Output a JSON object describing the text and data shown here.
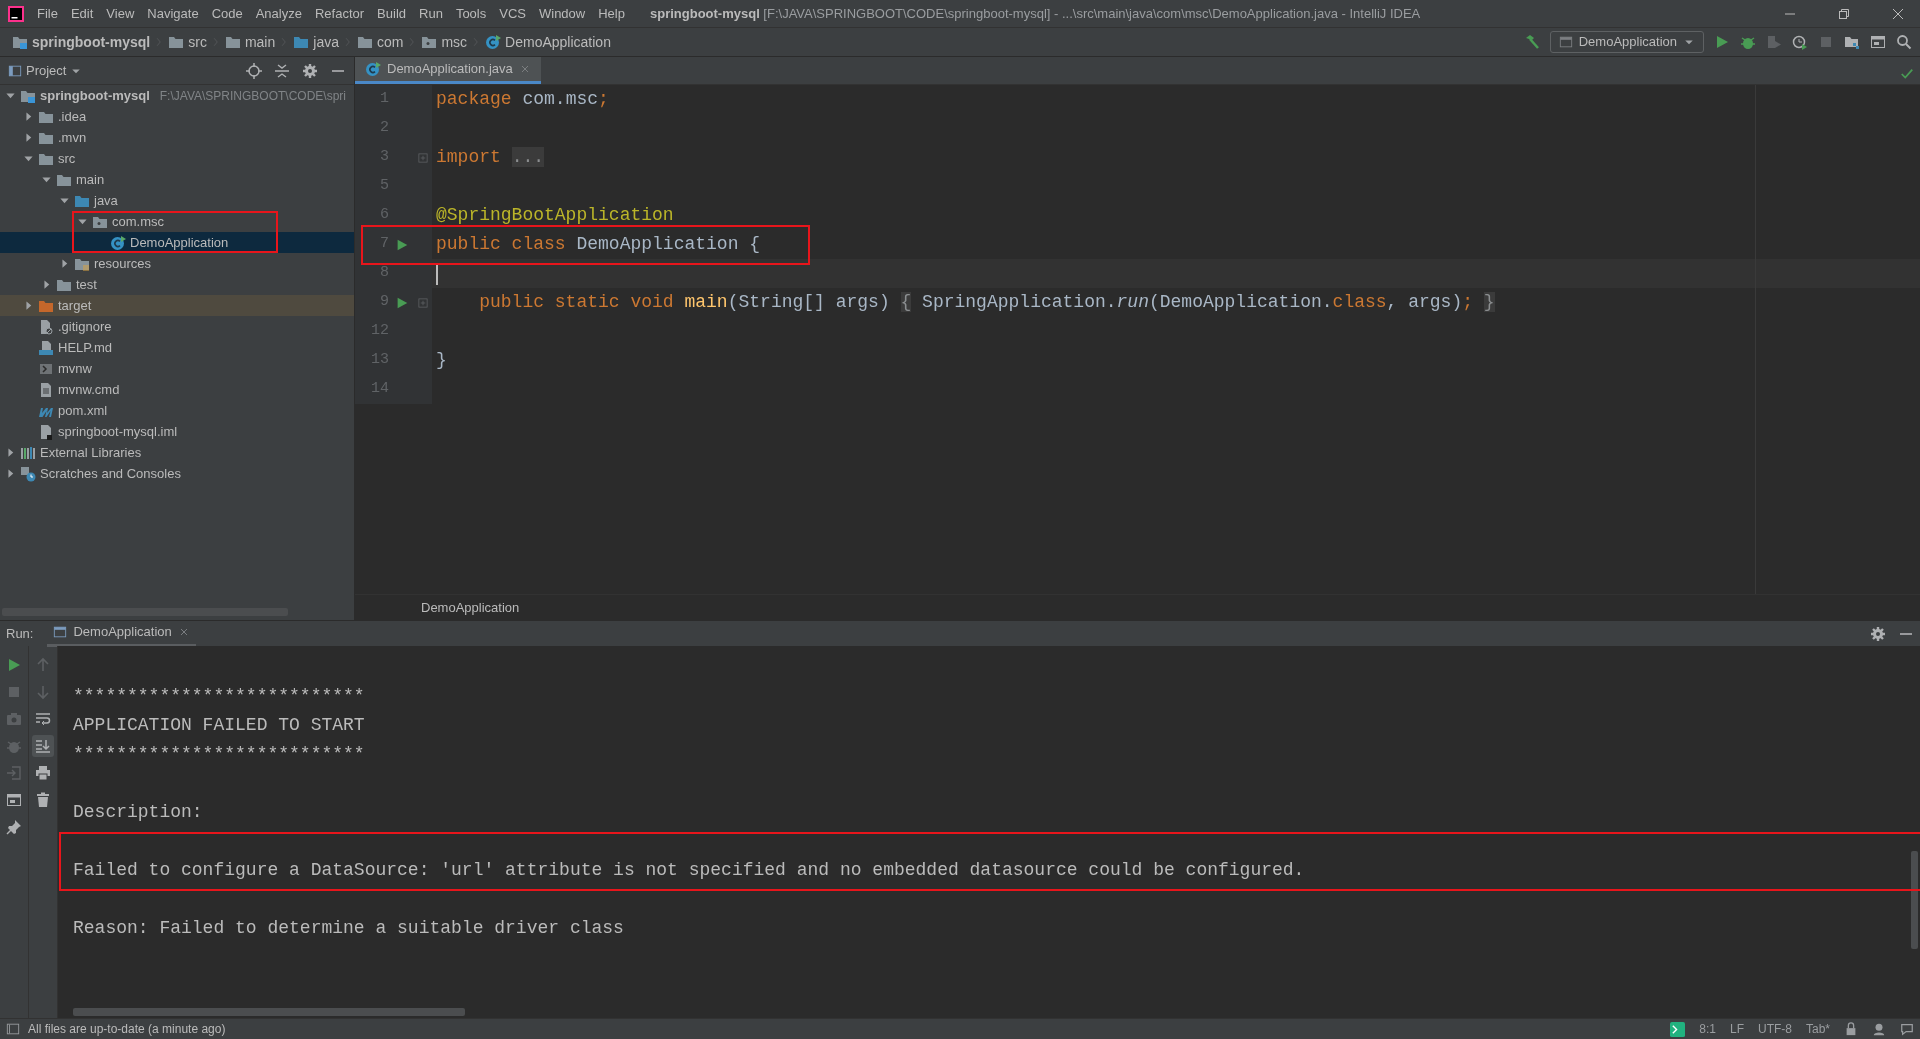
{
  "window": {
    "title": "**springboot-mysql** [F:\\JAVA\\SPRINGBOOT\\CODE\\springboot-mysql] - ...\\src\\main\\java\\com\\msc\\DemoApplication.java - IntelliJ IDEA"
  },
  "menu": [
    "File",
    "Edit",
    "View",
    "Navigate",
    "Code",
    "Analyze",
    "Refactor",
    "Build",
    "Run",
    "Tools",
    "VCS",
    "Window",
    "Help"
  ],
  "breadcrumb": [
    {
      "label": "springboot-mysql",
      "kind": "module"
    },
    {
      "label": "src",
      "kind": "folder"
    },
    {
      "label": "main",
      "kind": "folder"
    },
    {
      "label": "java",
      "kind": "source-folder"
    },
    {
      "label": "com",
      "kind": "folder"
    },
    {
      "label": "msc",
      "kind": "package"
    },
    {
      "label": "DemoApplication",
      "kind": "class"
    }
  ],
  "run_config": "DemoApplication",
  "toolbar": [
    {
      "kind": "run",
      "disabled": false
    },
    {
      "kind": "debug",
      "disabled": false
    },
    {
      "kind": "coverage",
      "disabled": true
    },
    {
      "kind": "profile",
      "disabled": false
    },
    {
      "kind": "stop",
      "disabled": true
    },
    {
      "kind": "structure",
      "disabled": false
    },
    {
      "kind": "layout",
      "disabled": false
    },
    {
      "kind": "search",
      "disabled": false
    }
  ],
  "project_panel": {
    "title": "Project",
    "tree": [
      {
        "label": "springboot-mysql",
        "path": "F:\\JAVA\\SPRINGBOOT\\CODE\\spri",
        "kind": "module",
        "expanded": true,
        "selected": false,
        "children": [
          {
            "label": ".idea",
            "kind": "folder",
            "expanded": false,
            "selected": false
          },
          {
            "label": ".mvn",
            "kind": "folder",
            "expanded": false,
            "selected": false
          },
          {
            "label": "src",
            "kind": "folder",
            "expanded": true,
            "selected": false,
            "children": [
              {
                "label": "main",
                "kind": "folder",
                "expanded": true,
                "selected": false,
                "children": [
                  {
                    "label": "java",
                    "kind": "source-folder",
                    "expanded": true,
                    "selected": false,
                    "children": [
                      {
                        "label": "com.msc",
                        "kind": "package",
                        "expanded": true,
                        "selected": false,
                        "highlighted": true,
                        "children": [
                          {
                            "label": "DemoApplication",
                            "kind": "class",
                            "selected": true,
                            "highlighted": true
                          }
                        ]
                      }
                    ]
                  },
                  {
                    "label": "resources",
                    "kind": "resources",
                    "expanded": false,
                    "selected": false
                  }
                ]
              },
              {
                "label": "test",
                "kind": "folder",
                "expanded": false,
                "selected": false
              }
            ]
          },
          {
            "label": "target",
            "kind": "excluded-folder",
            "expanded": false,
            "selected": false
          },
          {
            "label": ".gitignore",
            "kind": "ignore-file",
            "selected": false
          },
          {
            "label": "HELP.md",
            "kind": "markdown-file",
            "selected": false
          },
          {
            "label": "mvnw",
            "kind": "script-file",
            "selected": false
          },
          {
            "label": "mvnw.cmd",
            "kind": "text-file",
            "selected": false
          },
          {
            "label": "pom.xml",
            "kind": "build-file",
            "selected": false
          },
          {
            "label": "springboot-mysql.iml",
            "kind": "module-file",
            "selected": false
          }
        ]
      },
      {
        "label": "External Libraries",
        "kind": "libraries",
        "expanded": false,
        "selected": false
      },
      {
        "label": "Scratches and Consoles",
        "kind": "scratches",
        "expanded": false,
        "selected": false
      }
    ]
  },
  "editor": {
    "tab": {
      "label": "DemoApplication.java",
      "selected": true
    },
    "lines": [
      {
        "number": "1",
        "tokens": [
          {
            "text": "package",
            "kind": "keyword"
          },
          {
            "text": " com.msc",
            "kind": "plain"
          },
          {
            "text": ";",
            "kind": "keyword"
          }
        ]
      },
      {
        "number": "2"
      },
      {
        "number": "3",
        "fold": true,
        "tokens": [
          {
            "text": "import ",
            "kind": "keyword"
          },
          {
            "text": "...",
            "kind": "folded"
          }
        ]
      },
      {
        "number": "5"
      },
      {
        "number": "6",
        "tokens": [
          {
            "text": "@SpringBootApplication",
            "kind": "annotation"
          }
        ]
      },
      {
        "number": "7",
        "run_marker": true,
        "highlighted": true,
        "tokens": [
          {
            "text": "public class",
            "kind": "keyword"
          },
          {
            "text": " DemoApplication {",
            "kind": "plain"
          }
        ]
      },
      {
        "number": "8",
        "current": true
      },
      {
        "number": "9",
        "run_marker": true,
        "fold": true,
        "tokens": [
          {
            "text": "    public static void ",
            "kind": "keyword"
          },
          {
            "text": "main",
            "kind": "method"
          },
          {
            "text": "(String[] args) ",
            "kind": "plain"
          },
          {
            "text": "{",
            "kind": "folded"
          },
          {
            "text": " SpringApplication.",
            "kind": "plain"
          },
          {
            "text": "run",
            "kind": "call"
          },
          {
            "text": "(DemoApplication.",
            "kind": "plain"
          },
          {
            "text": "class",
            "kind": "keyword"
          },
          {
            "text": ", args)",
            "kind": "plain"
          },
          {
            "text": "; ",
            "kind": "keyword"
          },
          {
            "text": "}",
            "kind": "folded"
          }
        ]
      },
      {
        "number": "12"
      },
      {
        "number": "13",
        "tokens": [
          {
            "text": "}",
            "kind": "plain"
          }
        ]
      },
      {
        "number": "14"
      }
    ],
    "breadcrumb": "DemoApplication"
  },
  "run_panel": {
    "label": "Run:",
    "tab": "DemoApplication",
    "tools_left": [
      {
        "kind": "run",
        "disabled": false
      },
      {
        "kind": "stop",
        "disabled": true
      },
      {
        "kind": "camera",
        "disabled": true
      },
      {
        "kind": "debug",
        "disabled": true
      },
      {
        "kind": "exit",
        "disabled": true
      },
      {
        "kind": "layout",
        "disabled": false
      },
      {
        "kind": "pin",
        "disabled": false
      }
    ],
    "tools_right": [
      {
        "kind": "up",
        "selected": false
      },
      {
        "kind": "down",
        "selected": false
      },
      {
        "kind": "wrap",
        "selected": false
      },
      {
        "kind": "scroll-end",
        "selected": true
      },
      {
        "kind": "print",
        "selected": false
      },
      {
        "kind": "trash",
        "selected": false
      }
    ],
    "console": [
      {
        "text": "***************************"
      },
      {
        "text": "APPLICATION FAILED TO START"
      },
      {
        "text": "***************************"
      },
      {
        "text": "Description:",
        "blank_before": true
      },
      {
        "text": "Failed to configure a DataSource: 'url' attribute is not specified and no embedded datasource could be configured.",
        "blank_before": true,
        "highlighted": true
      },
      {
        "text": "Reason: Failed to determine a suitable driver class",
        "blank_before": true
      }
    ]
  },
  "status_bar": {
    "message": "All files are up-to-date (a minute ago)",
    "items": [
      "8:1",
      "LF",
      "UTF-8",
      "Tab*"
    ]
  }
}
